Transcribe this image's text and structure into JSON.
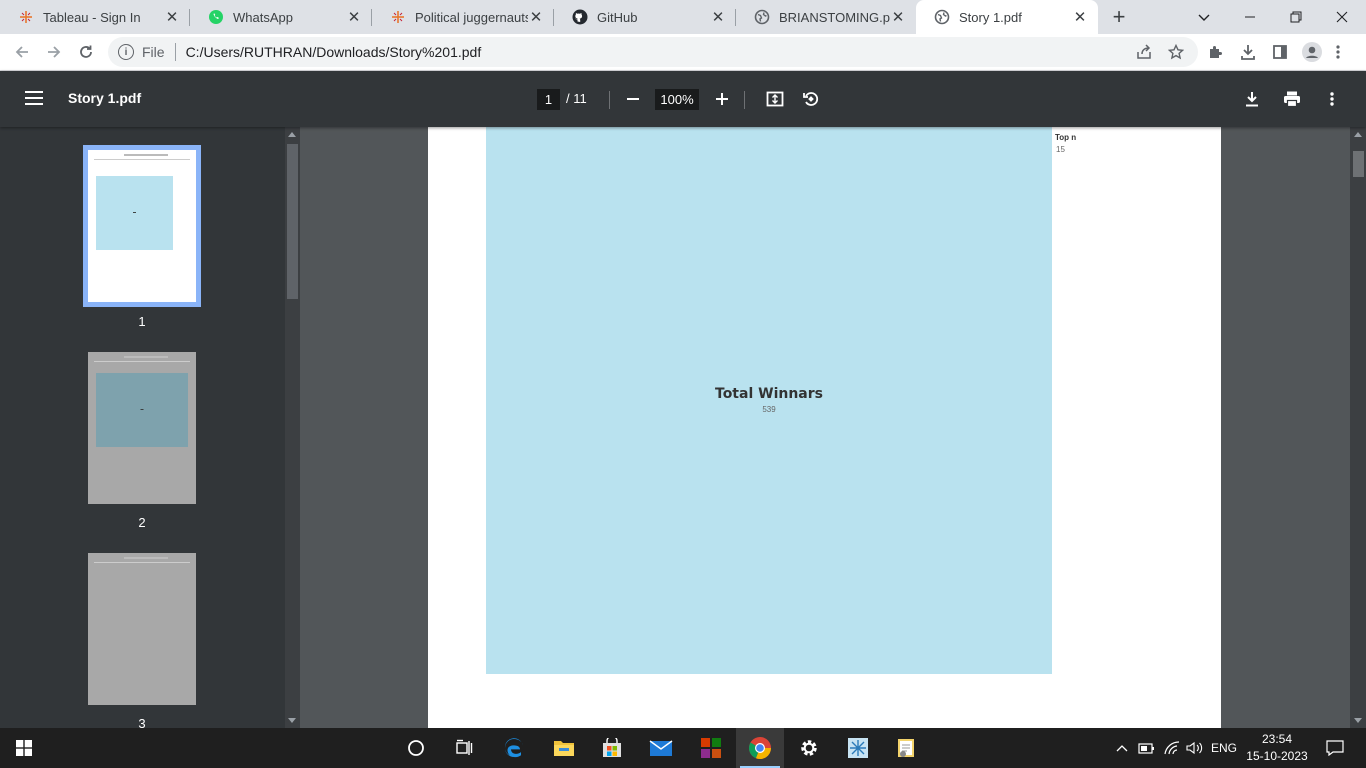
{
  "browser": {
    "tabs": [
      {
        "title": "Tableau - Sign In",
        "icon": "tableau-icon"
      },
      {
        "title": "WhatsApp",
        "icon": "whatsapp-icon"
      },
      {
        "title": "Political juggernauts |",
        "icon": "tableau-icon"
      },
      {
        "title": "GitHub",
        "icon": "github-icon"
      },
      {
        "title": "BRIANSTOMING.pdf",
        "icon": "globe-icon"
      },
      {
        "title": "Story 1.pdf",
        "icon": "globe-icon",
        "active": true
      }
    ],
    "address": {
      "scheme": "File",
      "url": "C:/Users/RUTHRAN/Downloads/Story%201.pdf"
    }
  },
  "pdf": {
    "title": "Story 1.pdf",
    "current_page": "1",
    "total_pages": "/ 11",
    "zoom": "100%",
    "thumbnails": [
      {
        "label": "1",
        "selected": true
      },
      {
        "label": "2",
        "selected": false
      },
      {
        "label": "3",
        "selected": false
      }
    ]
  },
  "document": {
    "viz_title": "Total Winnars",
    "viz_value": "539",
    "param_label": "Top n",
    "param_value": "15"
  },
  "taskbar": {
    "language": "ENG",
    "time": "23:54",
    "date": "15-10-2023"
  },
  "colors": {
    "viz_background": "#b9e2ef",
    "viewer_toolbar": "#323639",
    "selected_thumbnail": "#8ab4f8"
  }
}
